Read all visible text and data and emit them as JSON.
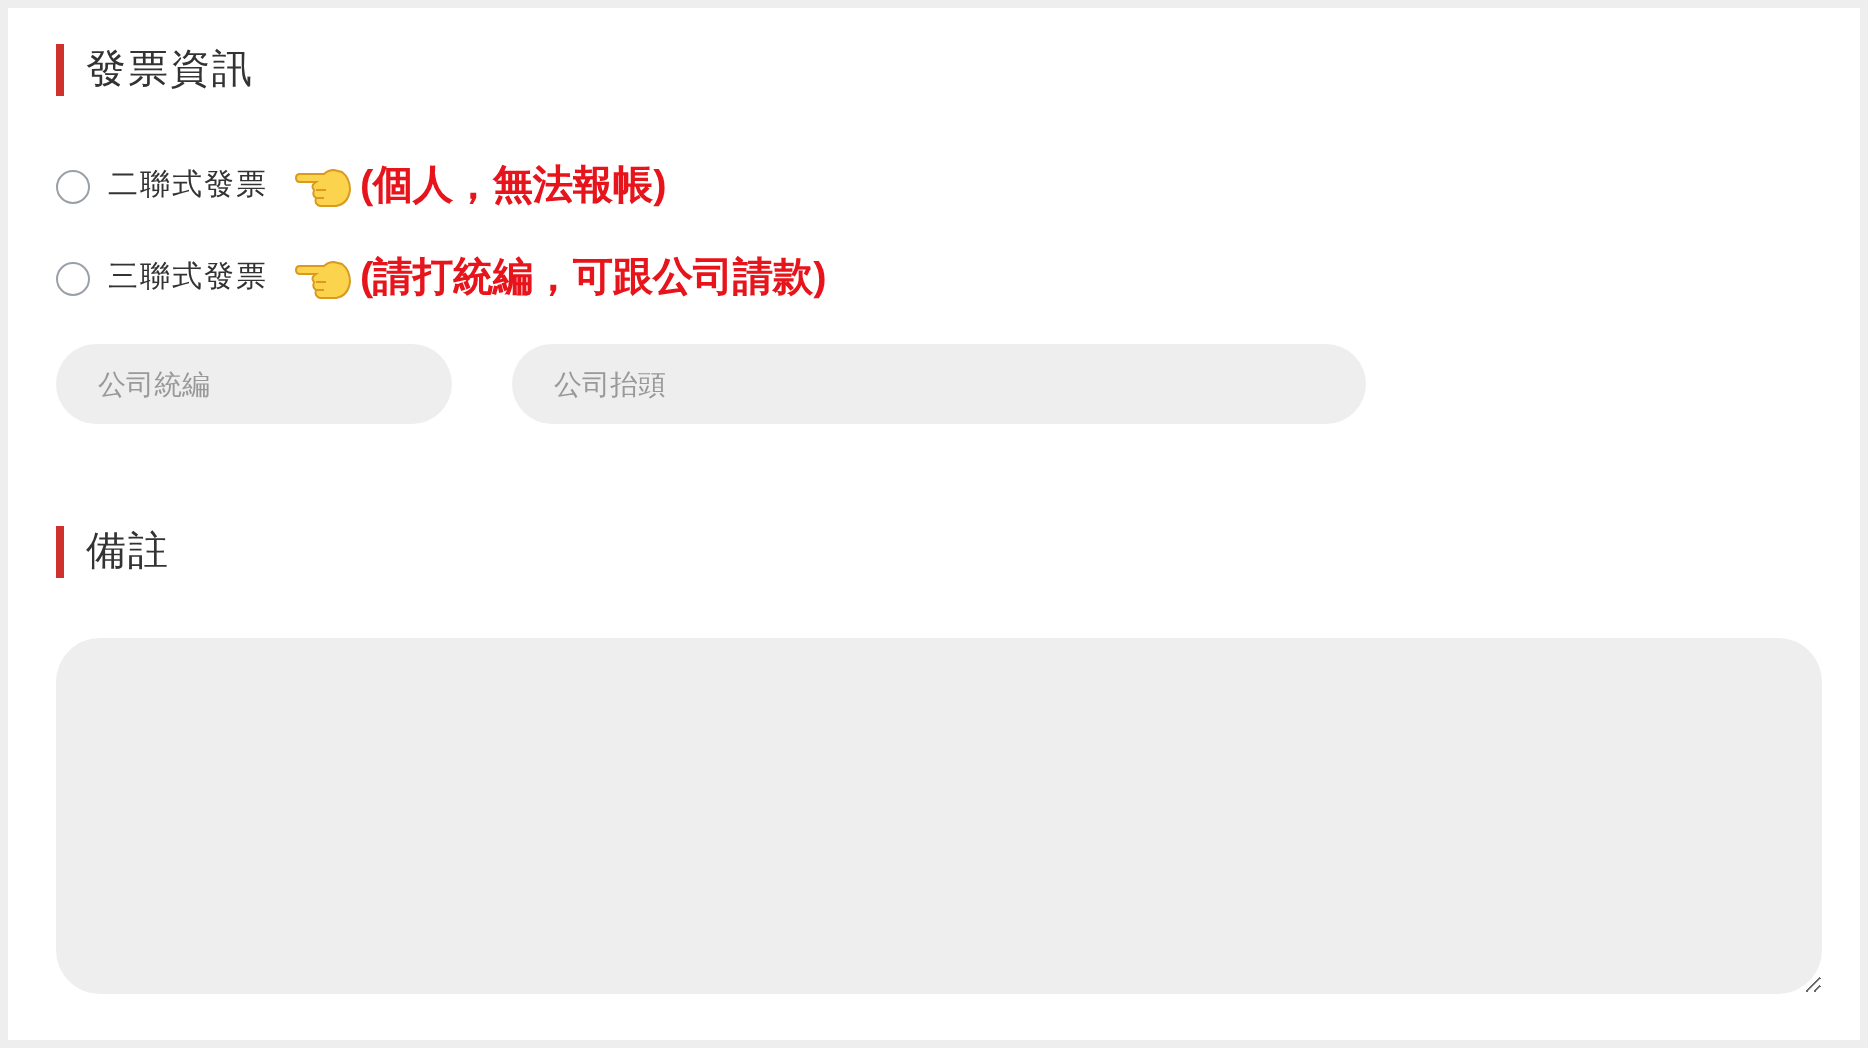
{
  "invoice": {
    "title": "發票資訊",
    "options": [
      {
        "label": "二聯式發票",
        "note": "(個人，無法報帳)",
        "selected": false
      },
      {
        "label": "三聯式發票",
        "note": "(請打統編，可跟公司請款)",
        "selected": false
      }
    ],
    "fields": [
      {
        "placeholder": "公司統編"
      },
      {
        "placeholder": "公司抬頭"
      }
    ]
  },
  "remarks": {
    "title": "備註"
  }
}
